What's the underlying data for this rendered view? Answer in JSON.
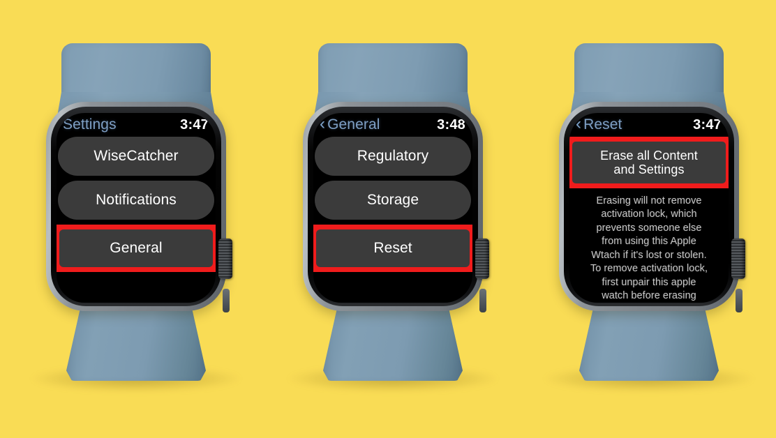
{
  "background_color": "#f9dc55",
  "accent_colors": {
    "highlight_red": "#f01c1c",
    "nav_blue": "#7e9fc4",
    "row_gray": "#3b3b3b",
    "band_blue": "#7e9cb2",
    "case_gray": "#8d9398"
  },
  "watches": [
    {
      "id": "watch-settings",
      "statusbar": {
        "title": "Settings",
        "back_icon": "",
        "time": "3:47"
      },
      "rows": [
        {
          "label": "WiseCatcher",
          "highlighted": false
        },
        {
          "label": "Notifications",
          "highlighted": false
        },
        {
          "label": "General",
          "highlighted": true
        }
      ],
      "paragraph": []
    },
    {
      "id": "watch-general",
      "statusbar": {
        "title": "General",
        "back_icon": "chevron-left-icon",
        "time": "3:48"
      },
      "rows": [
        {
          "label": "Regulatory",
          "highlighted": false
        },
        {
          "label": "Storage",
          "highlighted": false
        },
        {
          "label": "Reset",
          "highlighted": true
        }
      ],
      "paragraph": []
    },
    {
      "id": "watch-reset",
      "statusbar": {
        "title": "Reset",
        "back_icon": "chevron-left-icon",
        "time": "3:47"
      },
      "rows": [
        {
          "label": "Erase all Content and Settings",
          "line1": "Erase all Content",
          "line2": "and Settings",
          "highlighted": true
        }
      ],
      "paragraph": [
        "Erasing will not remove",
        "activation lock, which",
        "prevents someone else",
        "from using this Apple",
        "Wtach if it's lost or stolen.",
        "To remove activation lock,",
        "first unpair this apple",
        "watch before erasing"
      ]
    }
  ]
}
